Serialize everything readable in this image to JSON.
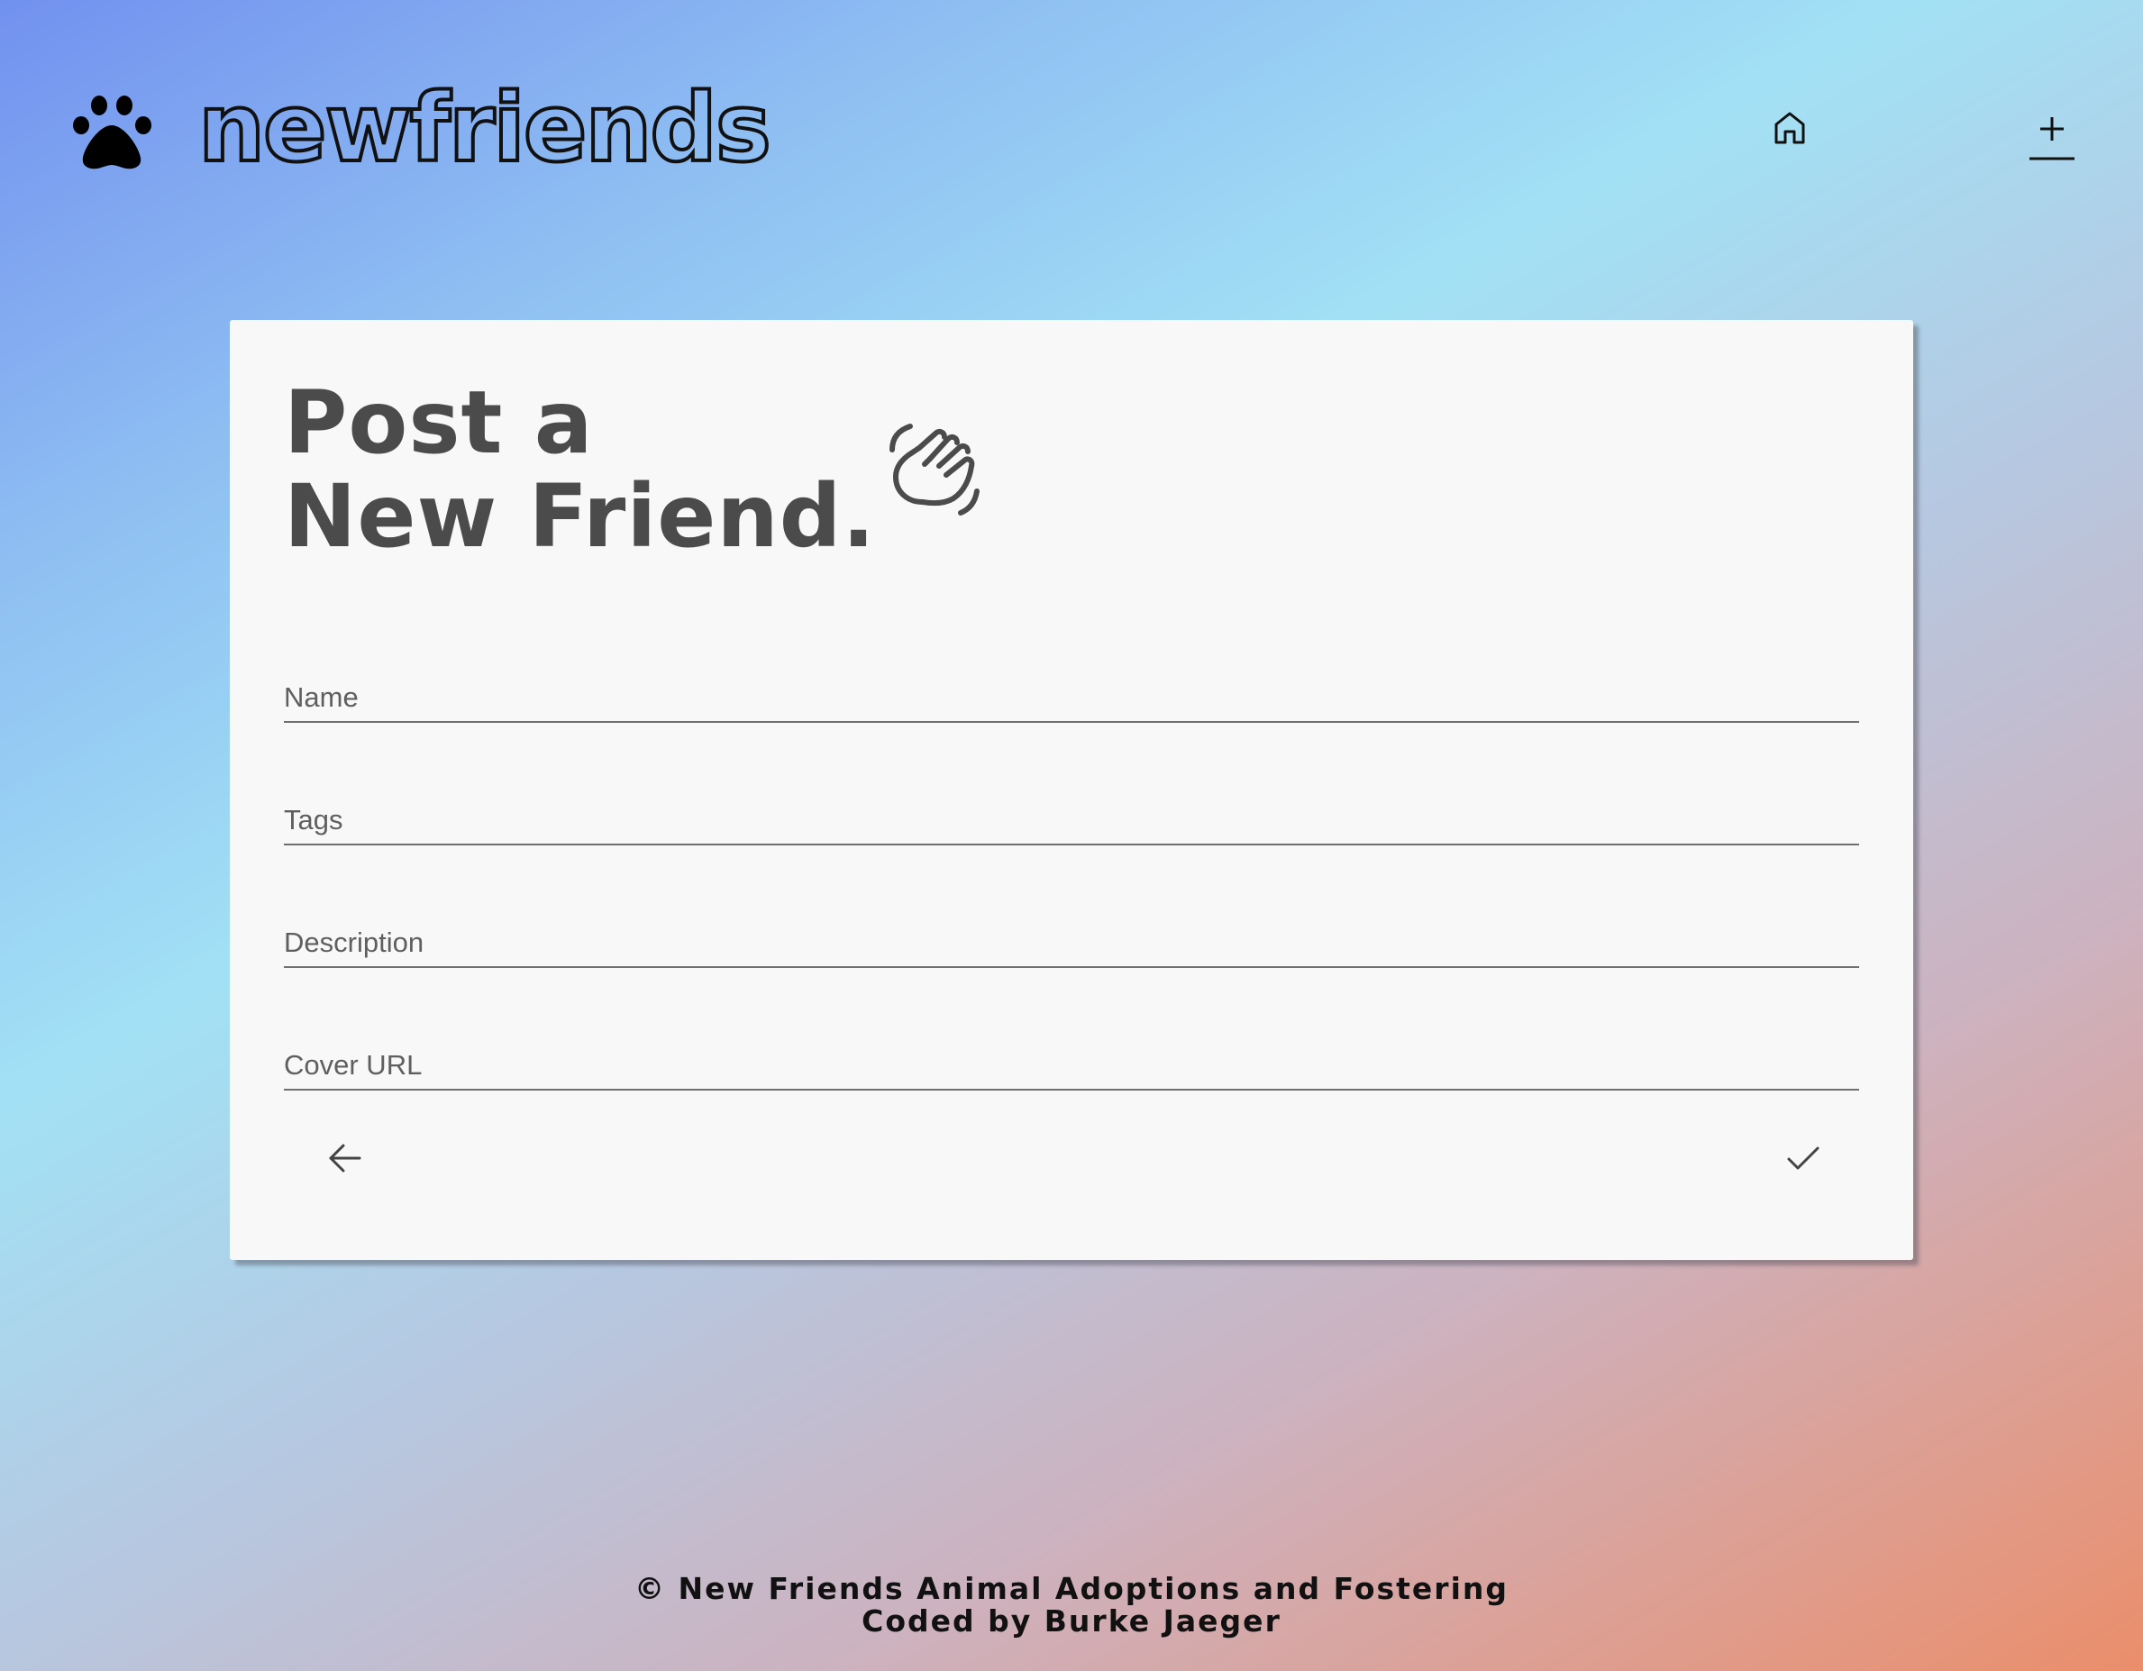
{
  "header": {
    "brand_name": "newfriends",
    "logo_icon": "paw-icon",
    "nav": [
      {
        "icon": "home-icon",
        "label": "Home"
      },
      {
        "icon": "add-icon",
        "label": "Add"
      }
    ]
  },
  "form": {
    "title_line1": "Post a",
    "title_line2": "New Friend.",
    "title_icon": "waving-hand-icon",
    "fields": {
      "name": {
        "placeholder": "Name",
        "value": ""
      },
      "tags": {
        "placeholder": "Tags",
        "value": ""
      },
      "description": {
        "placeholder": "Description",
        "value": ""
      },
      "cover_url": {
        "placeholder": "Cover URL",
        "value": ""
      }
    },
    "back_icon": "arrow-left-icon",
    "submit_icon": "checkmark-icon"
  },
  "footer": {
    "line1": "© New Friends Animal Adoptions and Fostering",
    "line2": "Coded by Burke Jaeger"
  },
  "colors": {
    "card_background": "#f8f8f8",
    "title_text": "#4b4b4b",
    "brand_text": "#111111"
  }
}
